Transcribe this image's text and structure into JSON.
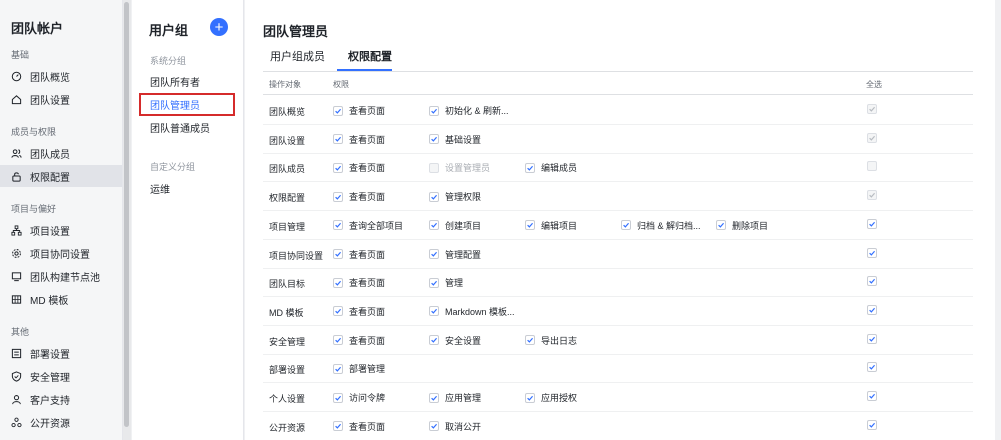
{
  "nav": {
    "title": "团队帐户",
    "groups": [
      {
        "label": "基础",
        "items": [
          {
            "label": "团队概览",
            "icon": "gauge-icon"
          },
          {
            "label": "团队设置",
            "icon": "home-icon"
          }
        ]
      },
      {
        "label": "成员与权限",
        "items": [
          {
            "label": "团队成员",
            "icon": "users-icon"
          },
          {
            "label": "权限配置",
            "icon": "lock-icon",
            "active": true
          }
        ]
      },
      {
        "label": "项目与偏好",
        "items": [
          {
            "label": "项目设置",
            "icon": "hierarchy-icon"
          },
          {
            "label": "项目协同设置",
            "icon": "gear-icon"
          },
          {
            "label": "团队构建节点池",
            "icon": "monitor-icon"
          },
          {
            "label": "MD 模板",
            "icon": "grid-icon"
          }
        ]
      },
      {
        "label": "其他",
        "items": [
          {
            "label": "部署设置",
            "icon": "list-icon"
          },
          {
            "label": "安全管理",
            "icon": "shield-icon"
          },
          {
            "label": "客户支持",
            "icon": "person-icon"
          },
          {
            "label": "公开资源",
            "icon": "share-icon"
          }
        ]
      }
    ]
  },
  "usergroups": {
    "title": "用户组",
    "add_label": "+",
    "system_label": "系统分组",
    "system_items": [
      "团队所有者",
      "团队管理员",
      "团队普通成员"
    ],
    "selected_index": 1,
    "custom_label": "自定义分组",
    "custom_items": [
      "运维"
    ]
  },
  "main": {
    "title": "团队管理员",
    "tabs": [
      "用户组成员",
      "权限配置"
    ],
    "active_tab": 1,
    "header": {
      "object": "操作对象",
      "permission": "权限",
      "select_all": "全选"
    },
    "rows": [
      {
        "label": "团队概览",
        "perms": [
          {
            "label": "查看页面",
            "checked": true
          },
          {
            "label": "初始化 & 刷新...",
            "checked": true
          }
        ],
        "all": "disabled"
      },
      {
        "label": "团队设置",
        "perms": [
          {
            "label": "查看页面",
            "checked": true
          },
          {
            "label": "基础设置",
            "checked": true
          }
        ],
        "all": "disabled"
      },
      {
        "label": "团队成员",
        "perms": [
          {
            "label": "查看页面",
            "checked": true
          },
          {
            "label": "设置管理员",
            "checked": false,
            "disabled": true
          },
          {
            "label": "编辑成员",
            "checked": true
          }
        ],
        "all": "empty"
      },
      {
        "label": "权限配置",
        "perms": [
          {
            "label": "查看页面",
            "checked": true
          },
          {
            "label": "管理权限",
            "checked": true
          }
        ],
        "all": "disabled"
      },
      {
        "label": "项目管理",
        "perms": [
          {
            "label": "查询全部项目",
            "checked": true
          },
          {
            "label": "创建项目",
            "checked": true
          },
          {
            "label": "编辑项目",
            "checked": true
          },
          {
            "label": "归档 & 解归档...",
            "checked": true
          },
          {
            "label": "删除项目",
            "checked": true
          }
        ],
        "all": "checked"
      },
      {
        "label": "项目协同设置",
        "perms": [
          {
            "label": "查看页面",
            "checked": true
          },
          {
            "label": "管理配置",
            "checked": true
          }
        ],
        "all": "checked"
      },
      {
        "label": "团队目标",
        "perms": [
          {
            "label": "查看页面",
            "checked": true
          },
          {
            "label": "管理",
            "checked": true
          }
        ],
        "all": "checked"
      },
      {
        "label": "MD 模板",
        "perms": [
          {
            "label": "查看页面",
            "checked": true
          },
          {
            "label": "Markdown 模板...",
            "checked": true
          }
        ],
        "all": "checked"
      },
      {
        "label": "安全管理",
        "perms": [
          {
            "label": "查看页面",
            "checked": true
          },
          {
            "label": "安全设置",
            "checked": true
          },
          {
            "label": "导出日志",
            "checked": true
          }
        ],
        "all": "checked"
      },
      {
        "label": "部署设置",
        "perms": [
          {
            "label": "部署管理",
            "checked": true
          }
        ],
        "all": "checked"
      },
      {
        "label": "个人设置",
        "perms": [
          {
            "label": "访问令牌",
            "checked": true
          },
          {
            "label": "应用管理",
            "checked": true
          },
          {
            "label": "应用授权",
            "checked": true
          }
        ],
        "all": "checked"
      },
      {
        "label": "公开资源",
        "perms": [
          {
            "label": "查看页面",
            "checked": true
          },
          {
            "label": "取消公开",
            "checked": true
          }
        ],
        "all": "checked"
      }
    ]
  },
  "colors": {
    "accent": "#3370ff",
    "highlight_border": "#d52b2b",
    "check": "#3370ff",
    "check_disabled": "#b8bcc2"
  }
}
